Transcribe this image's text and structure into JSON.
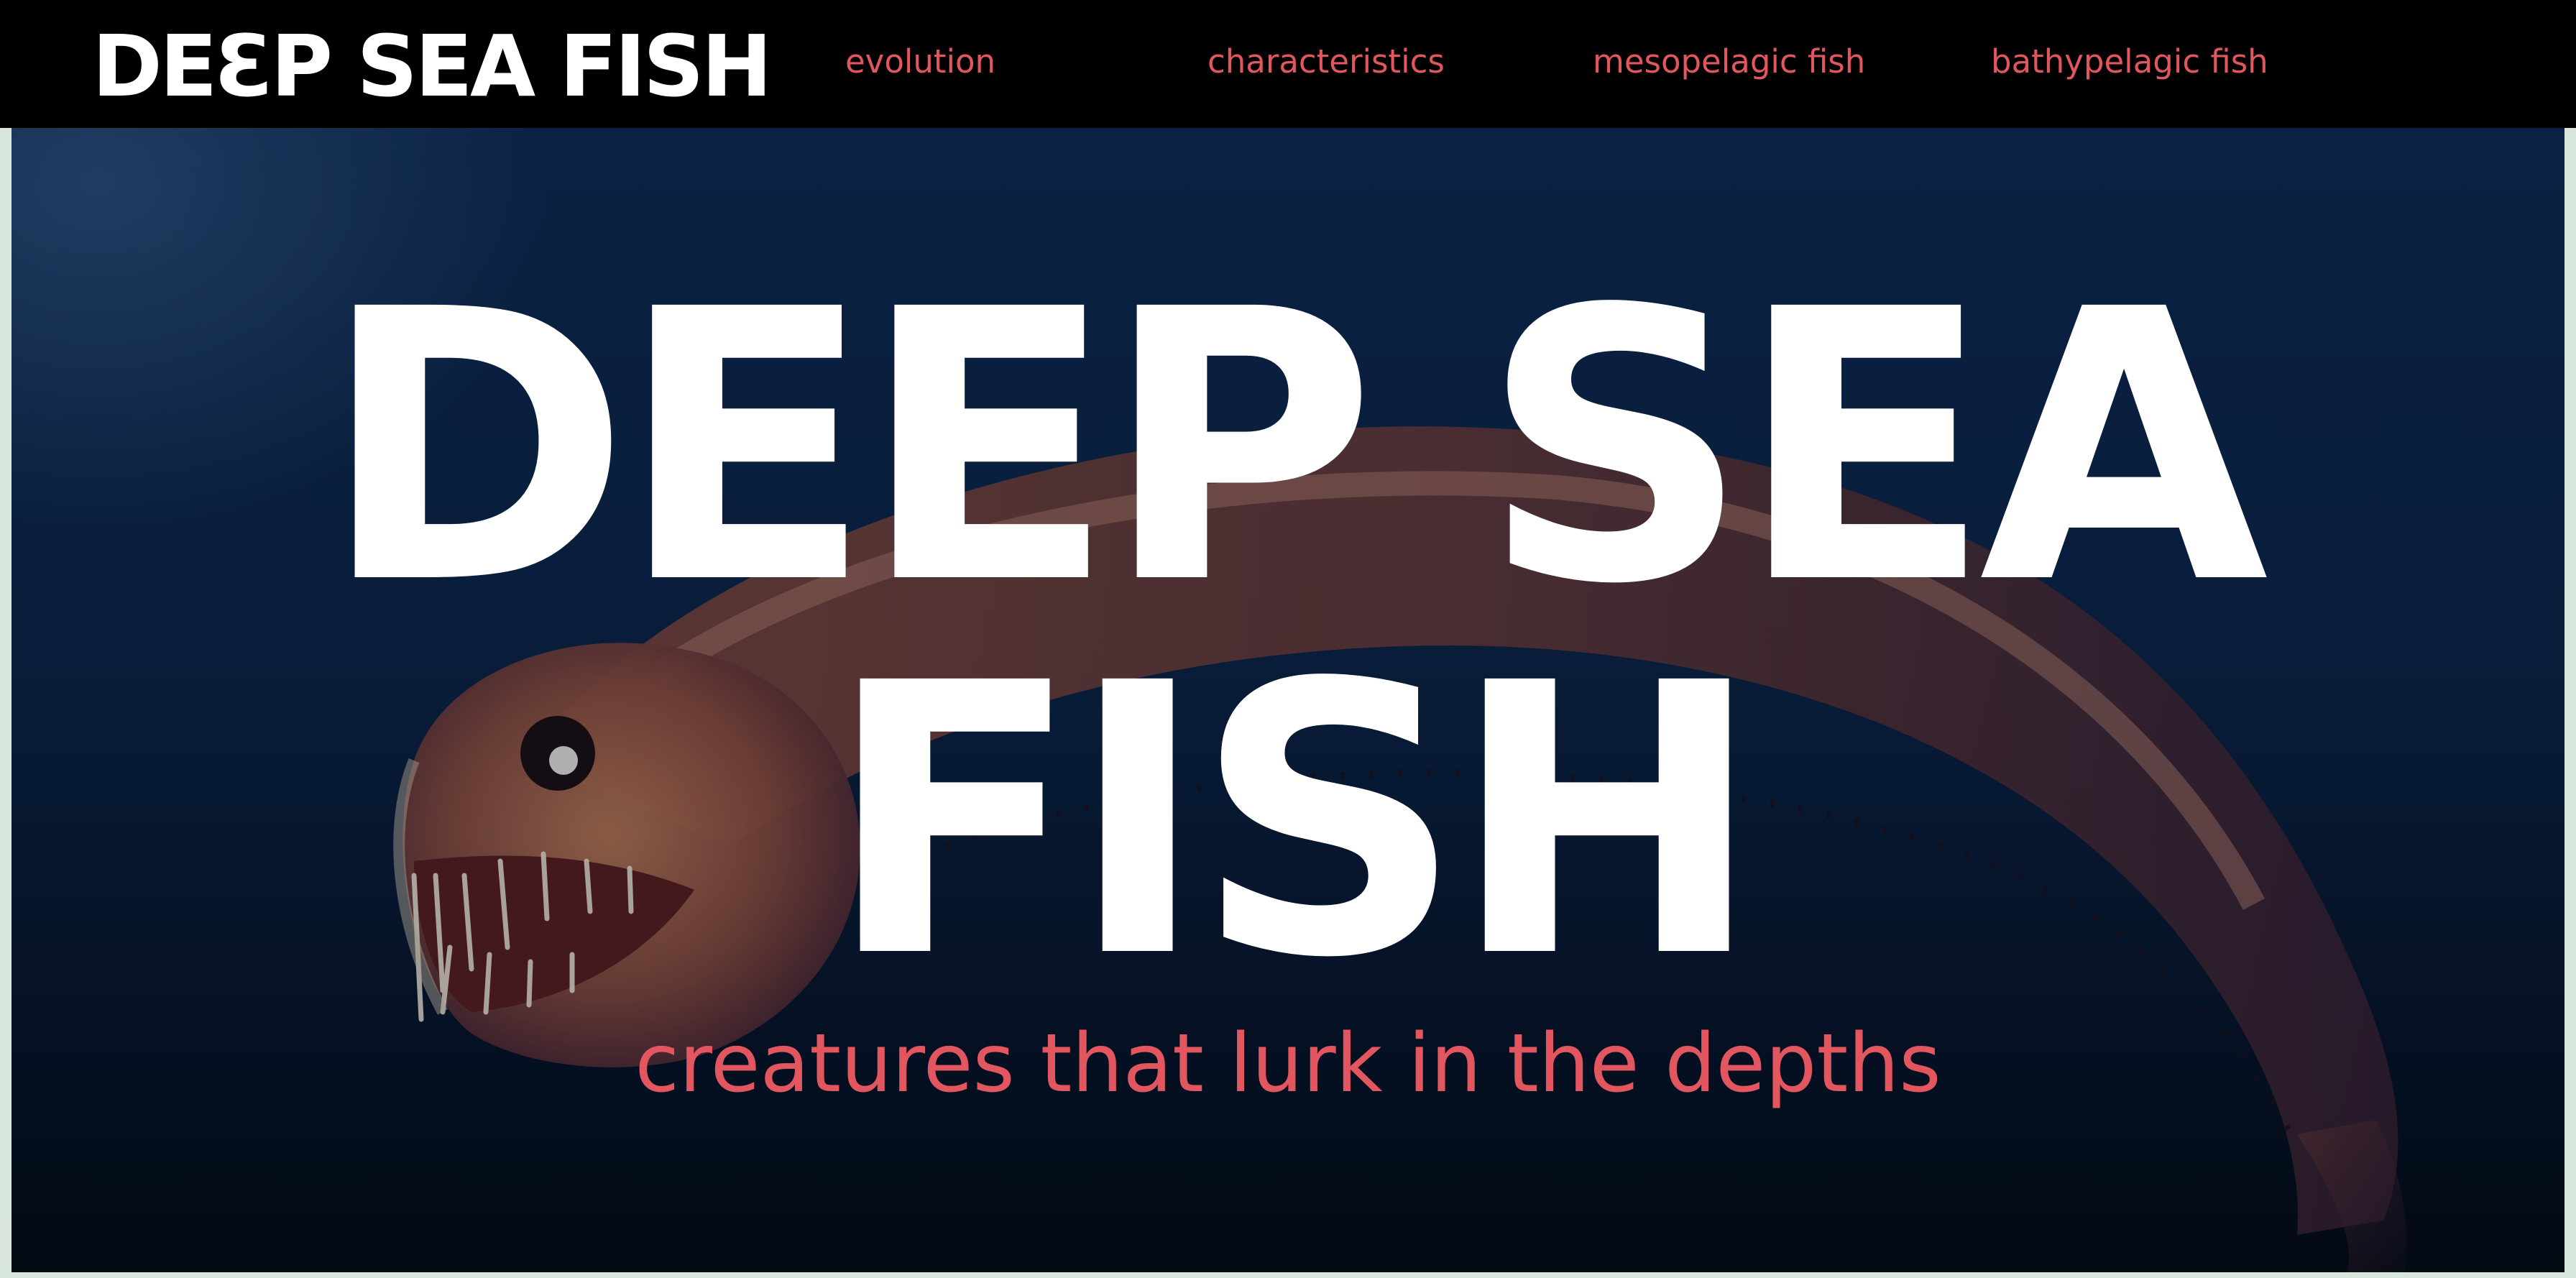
{
  "header": {
    "logo": "DEƐP SEA FISH",
    "nav": [
      {
        "label": "evolution"
      },
      {
        "label": "characteristics"
      },
      {
        "label": "mesopelagic fish"
      },
      {
        "label": "bathypelagic fish"
      }
    ]
  },
  "hero": {
    "title_line1": "DEEP SEA",
    "title_line2": "FISH",
    "tagline": "creatures that lurk in the depths",
    "image": "viperfish-photo"
  },
  "colors": {
    "header_bg": "#000000",
    "accent": "#e2565f",
    "title": "#ffffff",
    "ocean": "#0b2244"
  }
}
